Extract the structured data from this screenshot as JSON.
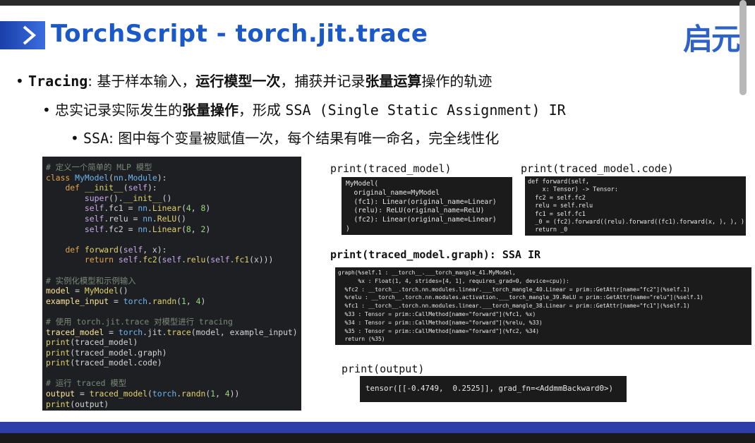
{
  "slide": {
    "title": "TorchScript - torch.jit.trace",
    "logo_text": "启元",
    "colors": {
      "title": "#1b58c8",
      "accent_bar": "#2d3ea8",
      "code_bg": "#1e1f22"
    }
  },
  "bullets": {
    "l1": {
      "dot": "•",
      "term": "Tracing",
      "colon": ": 基于样本输入，",
      "bold1": "运行模型一次",
      "mid": "，捕获并记录",
      "bold2": "张量运算",
      "tail": "操作的轨迹"
    },
    "l2": {
      "dot": "•",
      "pre": "忠实记录实际发生的",
      "bold": "张量操作",
      "mid": "，形成 ",
      "mono": "SSA (Single Static Assignment) IR"
    },
    "l3": {
      "dot": "•",
      "mono": "SSA",
      "text": ": 图中每个变量被赋值一次，每个结果有唯一命名，完全线性化"
    }
  },
  "code": {
    "c1": "# 定义一个简单的 MLP 模型",
    "c2": "# 实例化模型和示例输入",
    "c3": "# 使用 torch.jit.trace 对模型进行 tracing",
    "c4": "# 运行 traced 模型"
  },
  "outputs": {
    "print_model_label": "print(traced_model)",
    "print_model_text": "MyModel(\n  original_name=MyModel\n  (fc1): Linear(original_name=Linear)\n  (relu): ReLU(original_name=ReLU)\n  (fc2): Linear(original_name=Linear)\n)",
    "print_code_label": "print(traced_model.code)",
    "print_code_text": "def forward(self,\n    x: Tensor) -> Tensor:\n  fc2 = self.fc2\n  relu = self.relu\n  fc1 = self.fc1\n  _0 = (fc2).forward((relu).forward((fc1).forward(x, ), ), )\n  return _0",
    "print_graph_label": "print(traced_model.graph): SSA IR",
    "print_graph_text": "graph(%self.1 : __torch__.___torch_mangle_41.MyModel,\n      %x : Float(1, 4, strides=[4, 1], requires_grad=0, device=cpu)):\n  %fc2 : __torch__.torch.nn.modules.linear.___torch_mangle_40.Linear = prim::GetAttr[name=\"fc2\"](%self.1)\n  %relu : __torch__.torch.nn.modules.activation.___torch_mangle_39.ReLU = prim::GetAttr[name=\"relu\"](%self.1)\n  %fc1 : __torch__.torch.nn.modules.linear.___torch_mangle_38.Linear = prim::GetAttr[name=\"fc1\"](%self.1)\n  %33 : Tensor = prim::CallMethod[name=\"forward\"](%fc1, %x)\n  %34 : Tensor = prim::CallMethod[name=\"forward\"](%relu, %33)\n  %35 : Tensor = prim::CallMethod[name=\"forward\"](%fc2, %34)\n  return (%35)",
    "print_output_label": "print(output)",
    "print_output_text": "tensor([[-0.4749,  0.2525]], grad_fn=<AddmmBackward0>)"
  }
}
